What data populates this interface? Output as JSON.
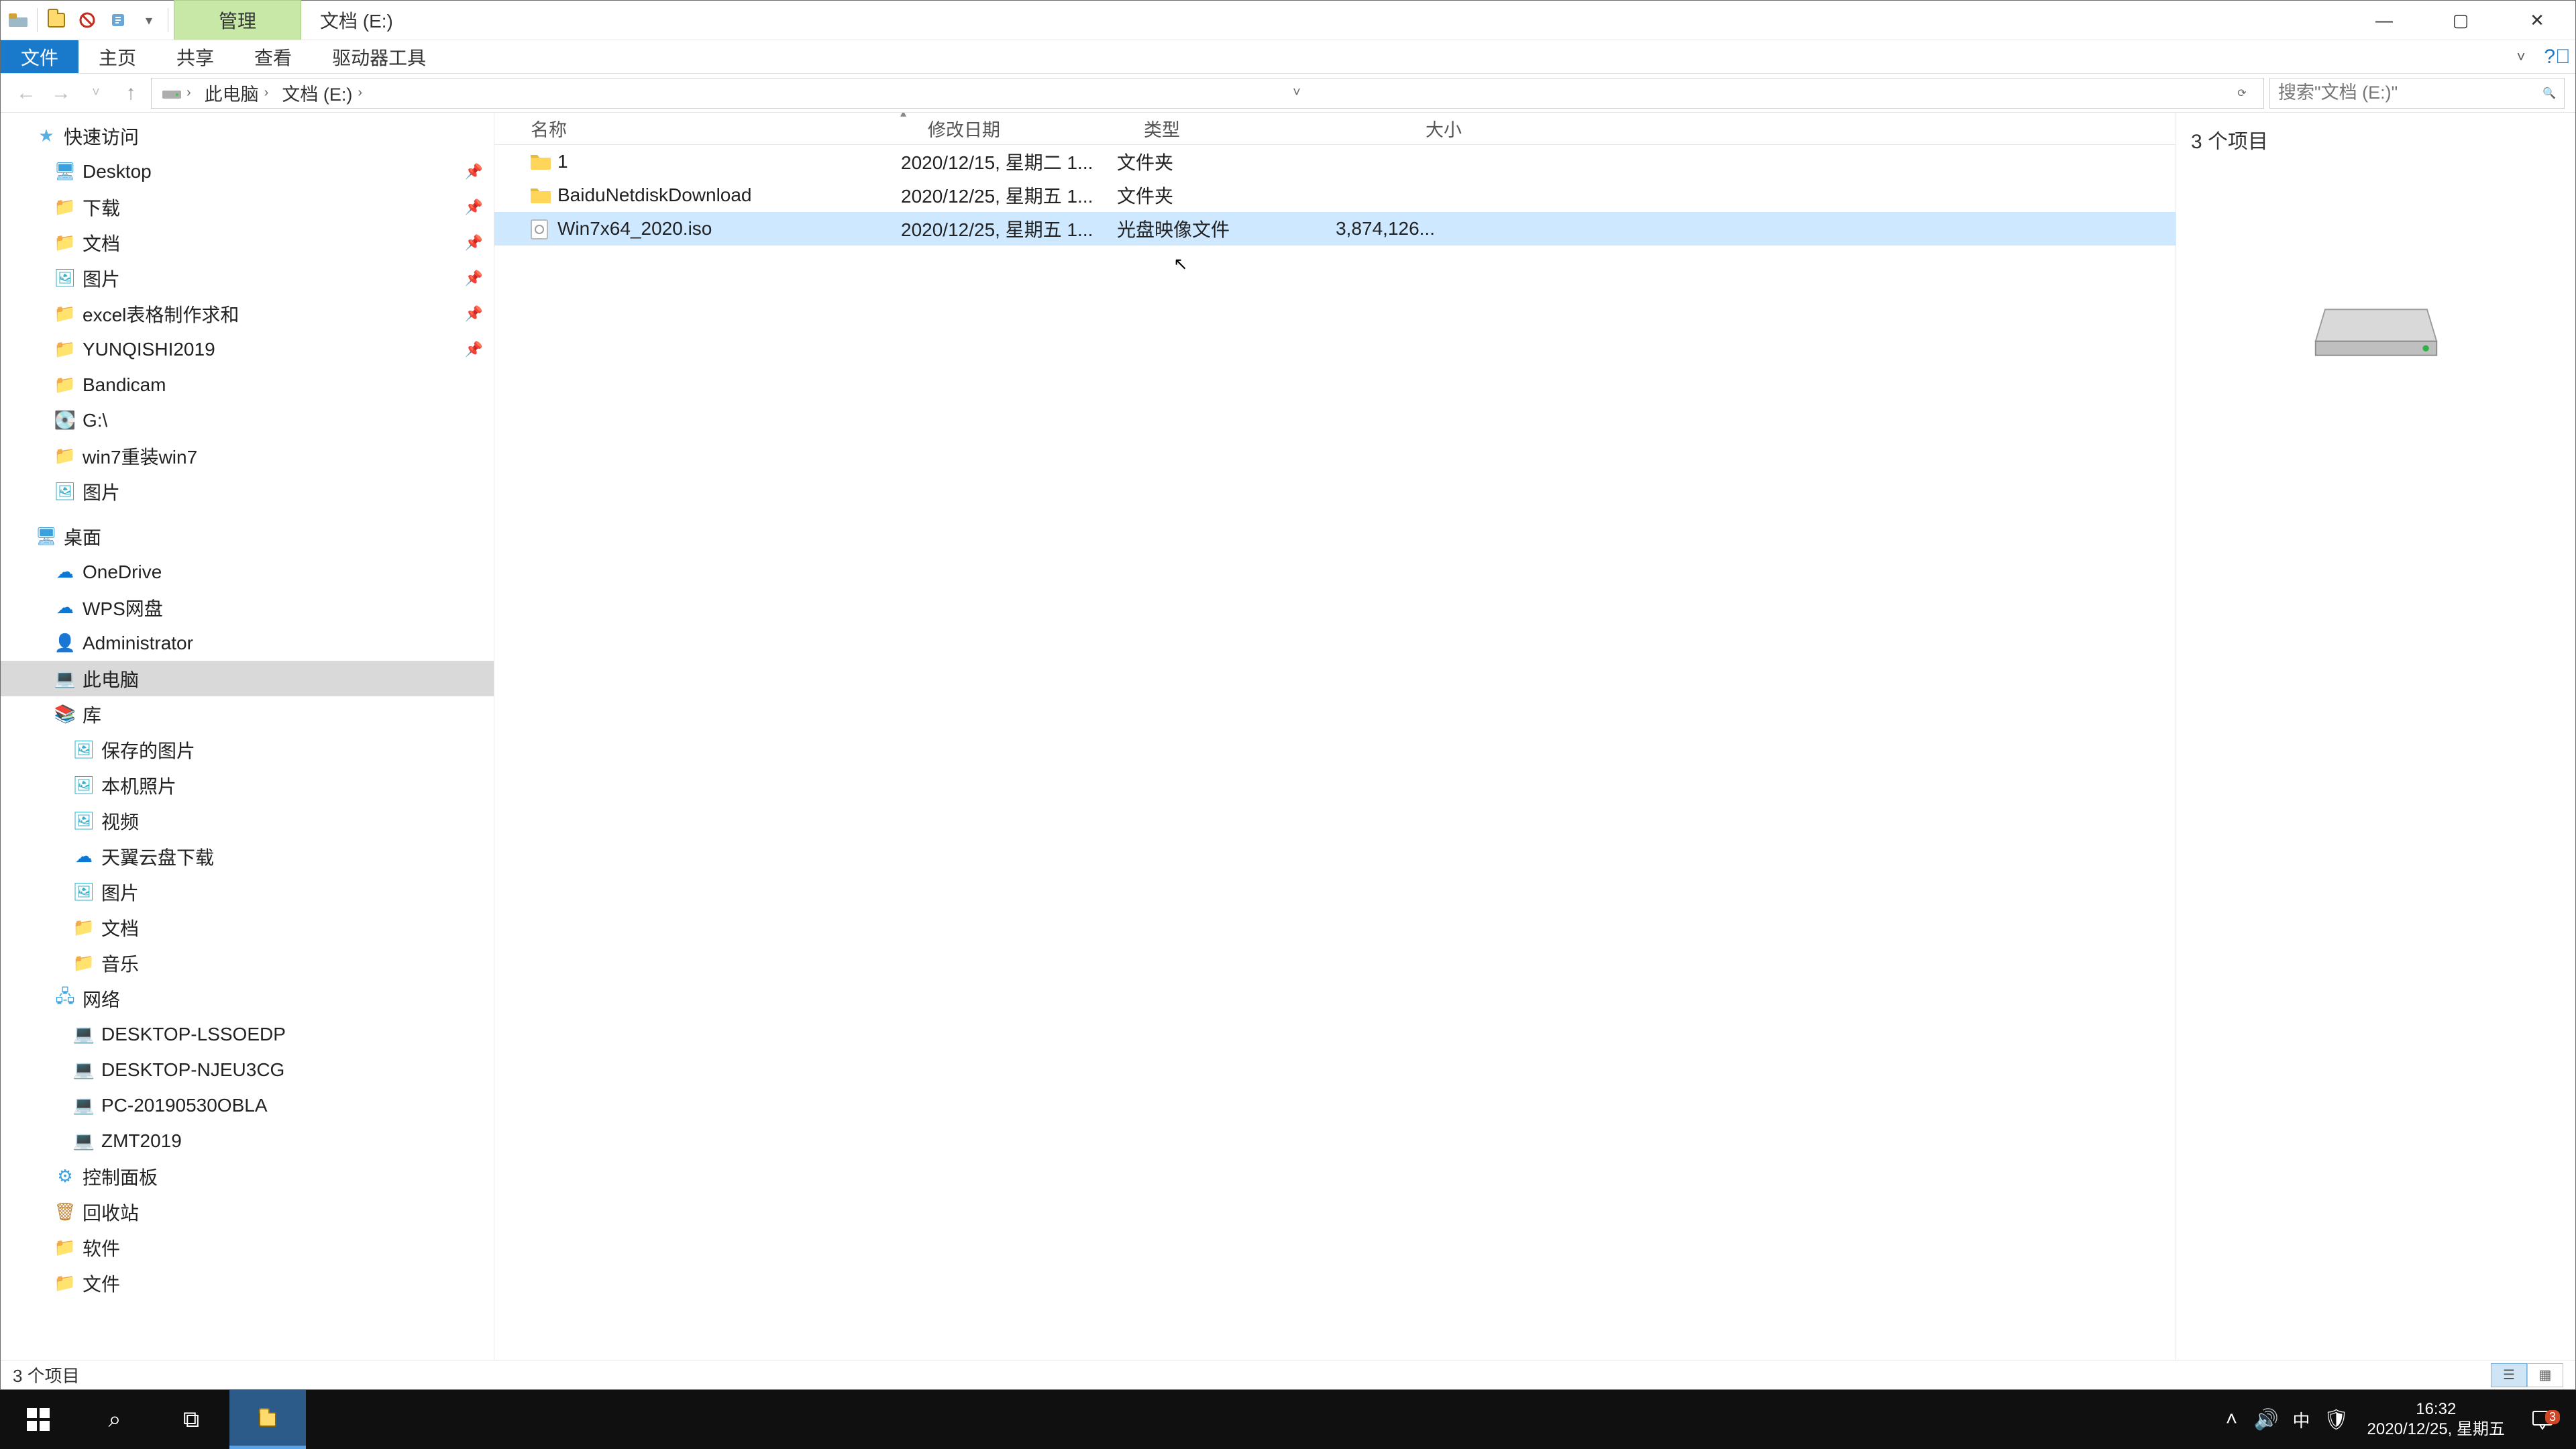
{
  "titlebar": {
    "context_tab": "管理",
    "title": "文档 (E:)"
  },
  "ribbon": {
    "file": "文件",
    "home": "主页",
    "share": "共享",
    "view": "查看",
    "drive_tools": "驱动器工具"
  },
  "breadcrumb": {
    "root": "此电脑",
    "loc": "文档 (E:)"
  },
  "search": {
    "placeholder": "搜索\"文档 (E:)\""
  },
  "nav": {
    "quick_access": "快速访问",
    "quick_items": [
      {
        "label": "Desktop",
        "icon": "ic-desktop",
        "pinned": true
      },
      {
        "label": "下载",
        "icon": "ic-folder",
        "pinned": true
      },
      {
        "label": "文档",
        "icon": "ic-folder",
        "pinned": true
      },
      {
        "label": "图片",
        "icon": "ic-pic",
        "pinned": true
      },
      {
        "label": "excel表格制作求和",
        "icon": "ic-folder",
        "pinned": true
      },
      {
        "label": "YUNQISHI2019",
        "icon": "ic-folder",
        "pinned": true
      },
      {
        "label": "Bandicam",
        "icon": "ic-folder",
        "pinned": false
      },
      {
        "label": "G:\\",
        "icon": "ic-drive",
        "pinned": false
      },
      {
        "label": "win7重装win7",
        "icon": "ic-folder",
        "pinned": false
      },
      {
        "label": "图片",
        "icon": "ic-pic",
        "pinned": false
      }
    ],
    "desktop": "桌面",
    "desktop_items": [
      {
        "label": "OneDrive",
        "icon": "ic-cloud"
      },
      {
        "label": "WPS网盘",
        "icon": "ic-cloud"
      },
      {
        "label": "Administrator",
        "icon": "ic-user"
      },
      {
        "label": "此电脑",
        "icon": "ic-pc",
        "selected": true
      },
      {
        "label": "库",
        "icon": "ic-lib"
      }
    ],
    "lib_items": [
      {
        "label": "保存的图片",
        "icon": "ic-pic"
      },
      {
        "label": "本机照片",
        "icon": "ic-pic"
      },
      {
        "label": "视频",
        "icon": "ic-pic"
      },
      {
        "label": "天翼云盘下载",
        "icon": "ic-cloud"
      },
      {
        "label": "图片",
        "icon": "ic-pic"
      },
      {
        "label": "文档",
        "icon": "ic-folder"
      },
      {
        "label": "音乐",
        "icon": "ic-folder"
      }
    ],
    "network": "网络",
    "network_items": [
      {
        "label": "DESKTOP-LSSOEDP"
      },
      {
        "label": "DESKTOP-NJEU3CG"
      },
      {
        "label": "PC-20190530OBLA"
      },
      {
        "label": "ZMT2019"
      }
    ],
    "tail": [
      {
        "label": "控制面板",
        "icon": "ic-panel"
      },
      {
        "label": "回收站",
        "icon": "ic-bin"
      },
      {
        "label": "软件",
        "icon": "ic-folder"
      },
      {
        "label": "文件",
        "icon": "ic-folder"
      }
    ]
  },
  "columns": {
    "name": "名称",
    "date": "修改日期",
    "type": "类型",
    "size": "大小"
  },
  "files": [
    {
      "name": "1",
      "date": "2020/12/15, 星期二 1...",
      "type": "文件夹",
      "size": "",
      "kind": "folder"
    },
    {
      "name": "BaiduNetdiskDownload",
      "date": "2020/12/25, 星期五 1...",
      "type": "文件夹",
      "size": "",
      "kind": "folder"
    },
    {
      "name": "Win7x64_2020.iso",
      "date": "2020/12/25, 星期五 1...",
      "type": "光盘映像文件",
      "size": "3,874,126...",
      "kind": "iso",
      "selected": true
    }
  ],
  "details": {
    "header": "3 个项目"
  },
  "status": {
    "text": "3 个项目"
  },
  "taskbar": {
    "time": "16:32",
    "date": "2020/12/25, 星期五",
    "ime": "中",
    "badge": "3"
  }
}
